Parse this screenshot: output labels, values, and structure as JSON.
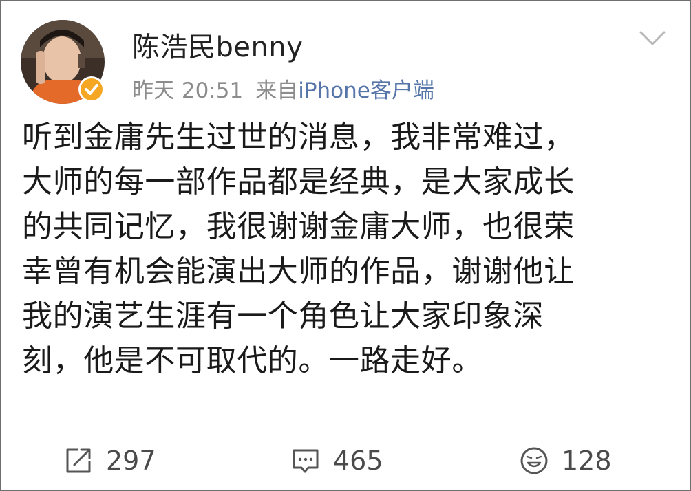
{
  "post": {
    "author": "陈浩民benny",
    "time": "昨天 20:51",
    "source_prefix": "来自",
    "source": "iPhone客户端",
    "lines": [
      "听到金庸先生过世的消息，我非常难过，",
      "大师的每一部作品都是经典，是大家成长",
      "的共同记忆，我很谢谢金庸大师，也很荣",
      "幸曾有机会能演出大师的作品，谢谢他让",
      "我的演艺生涯有一个角色让大家印象深",
      "刻，他是不可取代的。一路走好。"
    ]
  },
  "actions": {
    "reposts": "297",
    "comments": "465",
    "likes": "128"
  },
  "icons": {
    "chevron": "chevron-down-icon",
    "repost": "repost-icon",
    "comment": "comment-icon",
    "like": "like-icon",
    "verified": "verified-badge-icon"
  },
  "colors": {
    "text": "#1a1a1a",
    "meta": "#8c8c8c",
    "source_link": "#5676a9",
    "verified_badge": "#f5a623"
  }
}
